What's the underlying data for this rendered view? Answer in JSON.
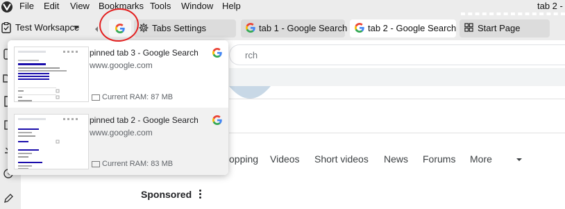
{
  "menubar": {
    "items": [
      "File",
      "Edit",
      "View",
      "Bookmarks",
      "Tools",
      "Window",
      "Help"
    ],
    "window_title": "tab 2 -"
  },
  "workspace": {
    "label": "Test Worksapce"
  },
  "tabs": [
    {
      "label": "Tabs Settings",
      "icon": "gear-icon"
    },
    {
      "label": "tab 1 - Google Search",
      "icon": "google-icon"
    },
    {
      "label": "tab 2 - Google Search",
      "icon": "google-icon",
      "active": true
    },
    {
      "label": "Start Page",
      "icon": "grid-icon"
    }
  ],
  "pinned_tab": {
    "icon": "google-icon"
  },
  "popup": {
    "cards": [
      {
        "title": "pinned tab 3 - Google Search",
        "url": "www.google.com",
        "ram": "Current RAM: 87 MB"
      },
      {
        "title": "pinned tab 2 - Google Search",
        "url": "www.google.com",
        "ram": "Current RAM: 83 MB"
      }
    ]
  },
  "page": {
    "search_placeholder": "rch",
    "tabs": [
      "opping",
      "Videos",
      "Short videos",
      "News",
      "Forums",
      "More"
    ],
    "sponsored": "Sponsored"
  },
  "colors": {
    "annotation_ring": "#e31f1f",
    "active_tab": "#ffffff",
    "inactive_tab": "#dcdcdc",
    "chrome": "#ececec"
  }
}
